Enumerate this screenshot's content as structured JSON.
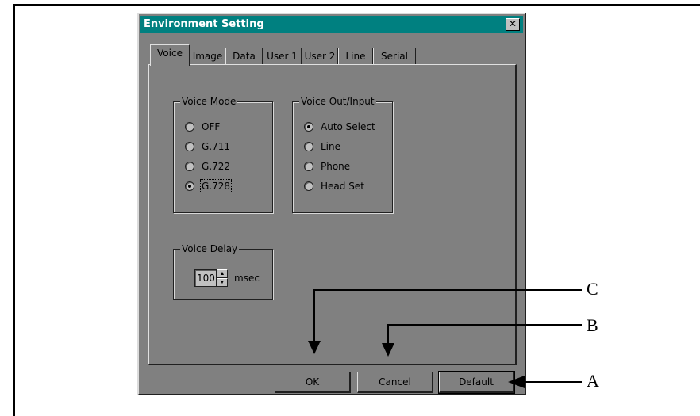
{
  "dialog": {
    "title": "Environment Setting",
    "close_glyph": "✕"
  },
  "tabs": [
    {
      "label": "Voice",
      "active": true
    },
    {
      "label": "Image"
    },
    {
      "label": "Data"
    },
    {
      "label": "User 1"
    },
    {
      "label": "User 2"
    },
    {
      "label": "Line"
    },
    {
      "label": "Serial"
    }
  ],
  "voice_mode": {
    "legend": "Voice Mode",
    "options": [
      "OFF",
      "G.711",
      "G.722",
      "G.728"
    ],
    "selected": "G.728"
  },
  "voice_out_input": {
    "legend": "Voice Out/Input",
    "options": [
      "Auto Select",
      "Line",
      "Phone",
      "Head Set"
    ],
    "selected": "Auto Select"
  },
  "voice_delay": {
    "legend": "Voice Delay",
    "value": "100",
    "unit": "msec"
  },
  "buttons": {
    "ok": "OK",
    "cancel": "Cancel",
    "default": "Default"
  },
  "callouts": {
    "a": "A",
    "b": "B",
    "c": "C"
  },
  "colors": {
    "dialog_bg": "#808080",
    "titlebar": "#008080"
  }
}
